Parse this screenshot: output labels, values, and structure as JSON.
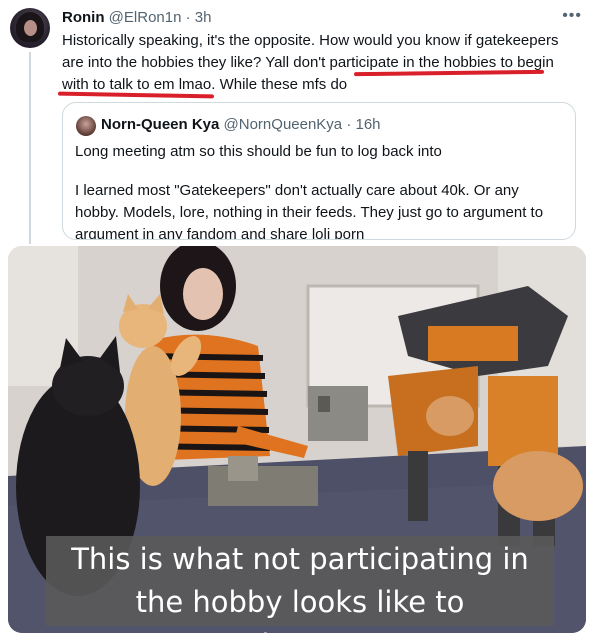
{
  "tweet": {
    "author_name": "Ronin",
    "author_handle": "@ElRon1n",
    "separator": " · ",
    "time": "3h",
    "more_icon": "more-horizontal-icon",
    "text_before_highlight": "Historically speaking, it's the opposite. How would you know if gatekeepers are into the hobbies they like? ",
    "text_highlight": "Yall don't participate in the hobbies to begin with",
    "text_after_highlight": " to talk to em lmao. While these mfs do",
    "highlight_color": "#d9202a"
  },
  "quoted": {
    "author_name": "Norn-Queen Kya",
    "author_handle": "@NornQueenKya",
    "separator": " · ",
    "time": "16h",
    "paragraph_1": "Long meeting atm so this should be fun to log back into",
    "paragraph_2": "I learned most \"Gatekeepers\" don't actually care about 40k. Or any hobby. Models, lore, nothing in their feeds. They just go to argument to argument in any fandom and share loli porn"
  },
  "media": {
    "caption": "This is what not participating in the hobby looks like to gatekeepers..."
  },
  "colors": {
    "text": "#0f1419",
    "secondary": "#536471",
    "border": "#cfd9de"
  }
}
